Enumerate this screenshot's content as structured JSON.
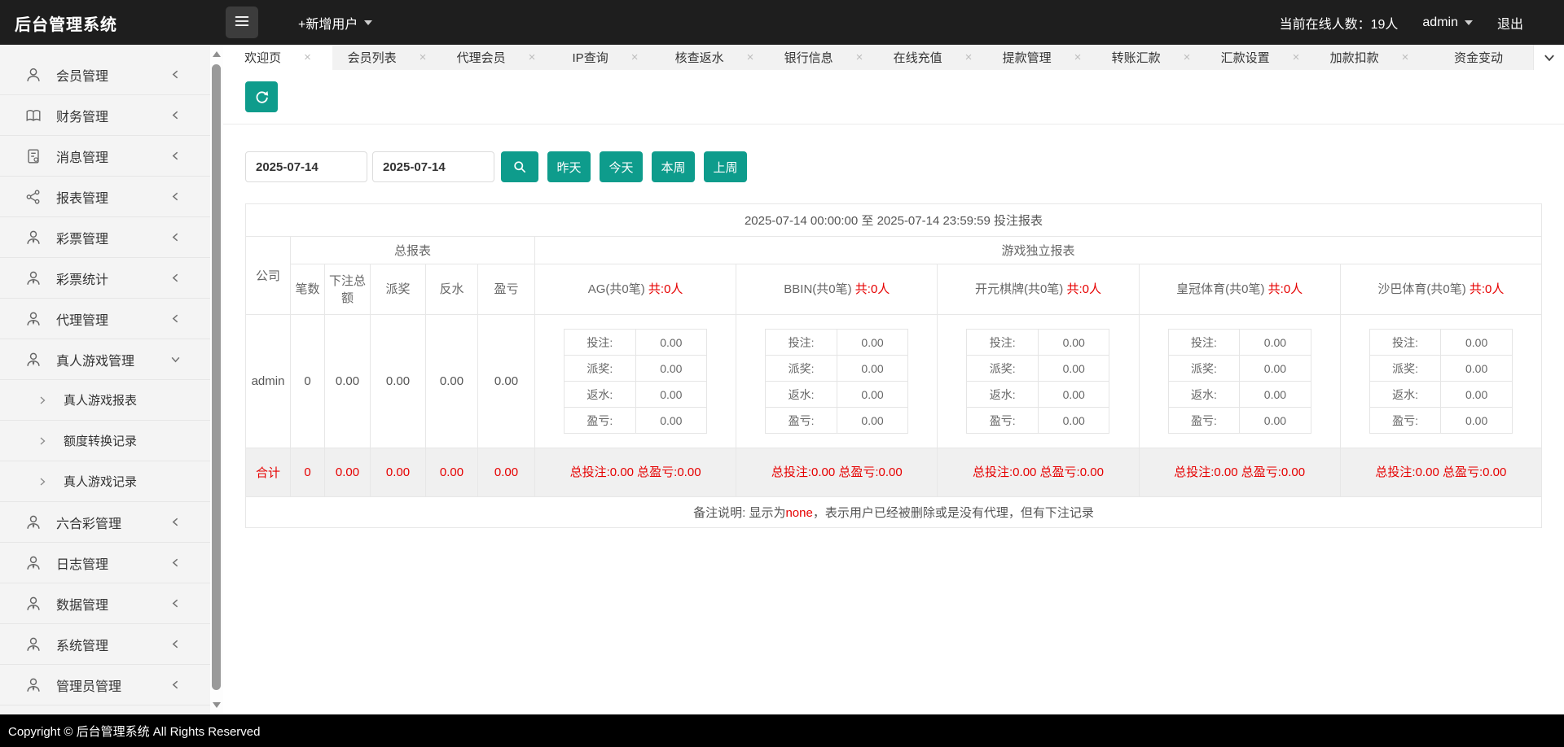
{
  "header": {
    "brand": "后台管理系统",
    "new_user": "+新增用户",
    "online": "当前在线人数：19人",
    "username": "admin",
    "logout": "退出"
  },
  "sidebar": {
    "items": [
      {
        "label": "会员管理"
      },
      {
        "label": "财务管理"
      },
      {
        "label": "消息管理"
      },
      {
        "label": "报表管理"
      },
      {
        "label": "彩票管理"
      },
      {
        "label": "彩票统计"
      },
      {
        "label": "代理管理"
      },
      {
        "label": "真人游戏管理",
        "expanded": true,
        "children": [
          {
            "label": "真人游戏报表"
          },
          {
            "label": "额度转换记录"
          },
          {
            "label": "真人游戏记录"
          }
        ]
      },
      {
        "label": "六合彩管理"
      },
      {
        "label": "日志管理"
      },
      {
        "label": "数据管理"
      },
      {
        "label": "系统管理"
      },
      {
        "label": "管理员管理"
      }
    ]
  },
  "tabs": [
    "欢迎页",
    "会员列表",
    "代理会员",
    "IP查询",
    "核查返水",
    "银行信息",
    "在线充值",
    "提款管理",
    "转账汇款",
    "汇款设置",
    "加款扣款",
    "资金变动"
  ],
  "filters": {
    "date_from": "2025-07-14",
    "date_to": "2025-07-14",
    "yesterday": "昨天",
    "today": "今天",
    "this_week": "本周",
    "last_week": "上周"
  },
  "report": {
    "title": "2025-07-14 00:00:00 至 2025-07-14 23:59:59 投注报表",
    "company_col": "公司",
    "total_group": "总报表",
    "games_group": "游戏独立报表",
    "total_cols": [
      "笔数",
      "下注总额",
      "派奖",
      "反水",
      "盈亏"
    ],
    "games": [
      {
        "name": "AG(共0笔)",
        "players": "共:0人",
        "stats": [
          {
            "label": "投注:",
            "value": "0.00"
          },
          {
            "label": "派奖:",
            "value": "0.00"
          },
          {
            "label": "返水:",
            "value": "0.00"
          },
          {
            "label": "盈亏:",
            "value": "0.00"
          }
        ],
        "summary": "总投注:0.00 总盈亏:0.00"
      },
      {
        "name": "BBIN(共0笔)",
        "players": "共:0人",
        "stats": [
          {
            "label": "投注:",
            "value": "0.00"
          },
          {
            "label": "派奖:",
            "value": "0.00"
          },
          {
            "label": "返水:",
            "value": "0.00"
          },
          {
            "label": "盈亏:",
            "value": "0.00"
          }
        ],
        "summary": "总投注:0.00 总盈亏:0.00"
      },
      {
        "name": "开元棋牌(共0笔)",
        "players": "共:0人",
        "stats": [
          {
            "label": "投注:",
            "value": "0.00"
          },
          {
            "label": "派奖:",
            "value": "0.00"
          },
          {
            "label": "返水:",
            "value": "0.00"
          },
          {
            "label": "盈亏:",
            "value": "0.00"
          }
        ],
        "summary": "总投注:0.00 总盈亏:0.00"
      },
      {
        "name": "皇冠体育(共0笔)",
        "players": "共:0人",
        "stats": [
          {
            "label": "投注:",
            "value": "0.00"
          },
          {
            "label": "派奖:",
            "value": "0.00"
          },
          {
            "label": "返水:",
            "value": "0.00"
          },
          {
            "label": "盈亏:",
            "value": "0.00"
          }
        ],
        "summary": "总投注:0.00 总盈亏:0.00"
      },
      {
        "name": "沙巴体育(共0笔)",
        "players": "共:0人",
        "stats": [
          {
            "label": "投注:",
            "value": "0.00"
          },
          {
            "label": "派奖:",
            "value": "0.00"
          },
          {
            "label": "返水:",
            "value": "0.00"
          },
          {
            "label": "盈亏:",
            "value": "0.00"
          }
        ],
        "summary": "总投注:0.00 总盈亏:0.00"
      }
    ],
    "rows": [
      {
        "company": "admin",
        "bets": "0",
        "bet_total": "0.00",
        "payout": "0.00",
        "rebate": "0.00",
        "profit": "0.00"
      }
    ],
    "summary": {
      "label": "合计",
      "bets": "0",
      "bet_total": "0.00",
      "payout": "0.00",
      "rebate": "0.00",
      "profit": "0.00"
    },
    "note_prefix": "备注说明: 显示为",
    "note_highlight": "none",
    "note_suffix": "，表示用户已经被删除或是没有代理，但有下注记录"
  },
  "footer": {
    "copyright": "Copyright © 后台管理系统 All Rights Reserved"
  },
  "colors": {
    "accent_teal": "#0e9c8c",
    "alert_red": "#e60000"
  }
}
